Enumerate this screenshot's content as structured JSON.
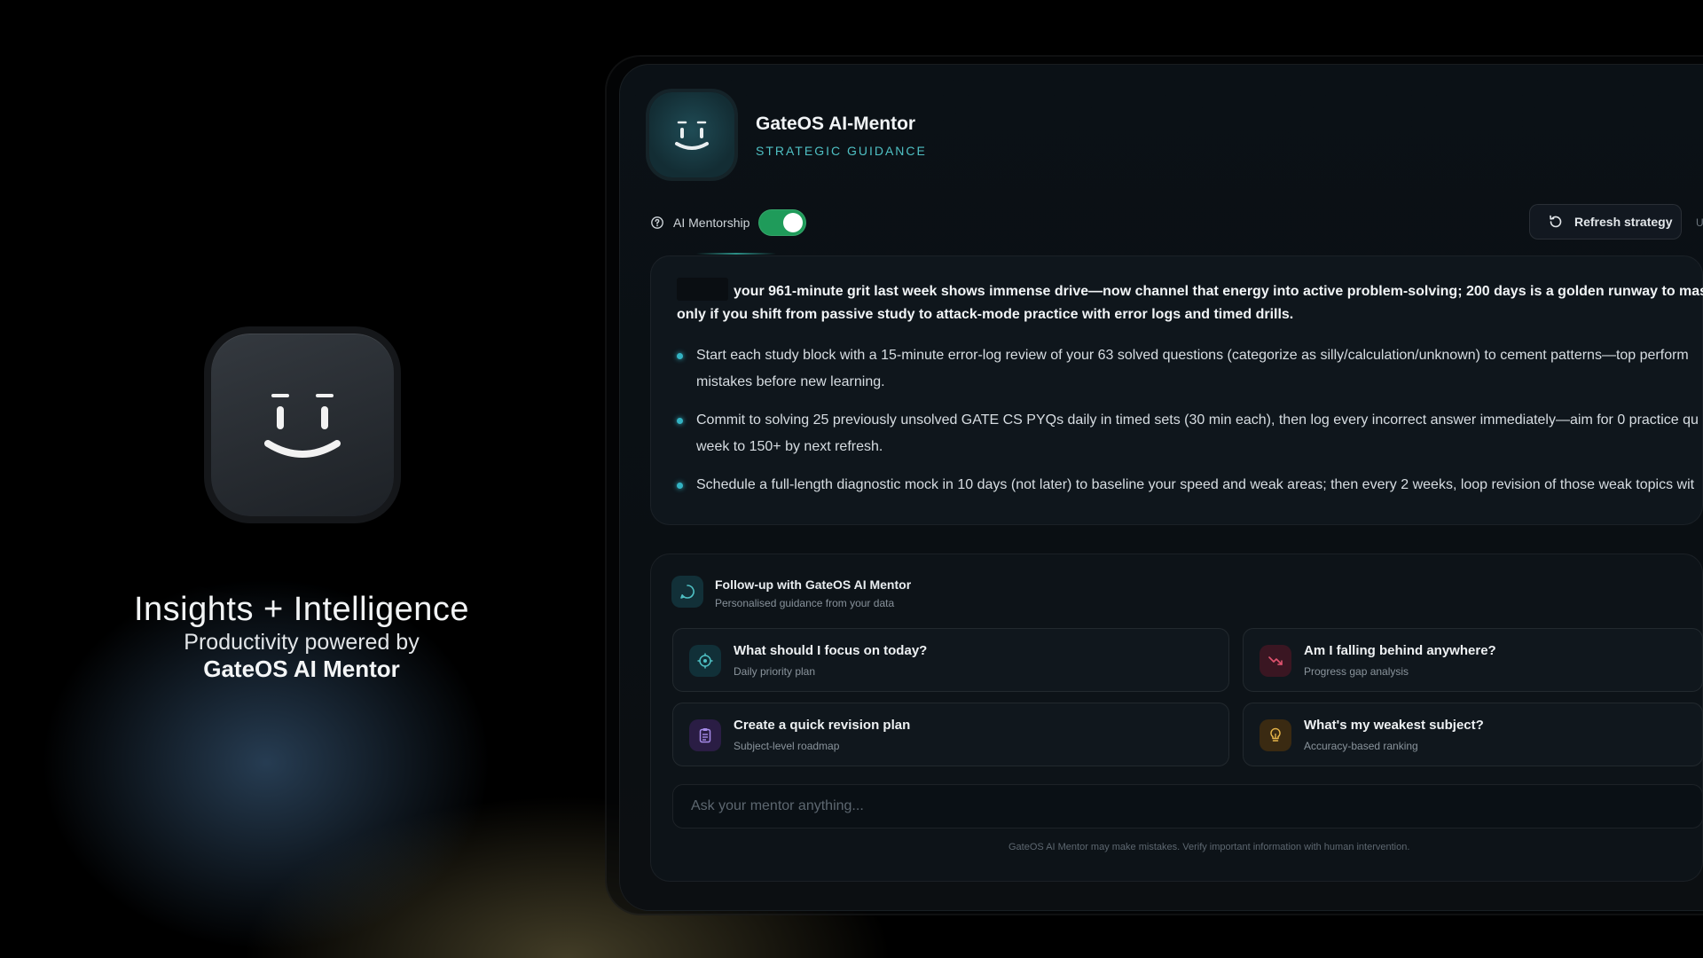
{
  "hero": {
    "title": "Insights + Intelligence",
    "subtitle": "Productivity powered by",
    "brand": "GateOS AI Mentor"
  },
  "header": {
    "title": "GateOS AI-Mentor",
    "subtitle": "STRATEGIC GUIDANCE"
  },
  "controls": {
    "mentorship_label": "AI Mentorship",
    "mentorship_enabled": true,
    "refresh_label": "Refresh strategy",
    "edge_fragment": "U"
  },
  "strategy": {
    "lead_line1": "your 961-minute grit last week shows immense drive—now channel that energy into active problem-solving; 200 days is a golden runway to master",
    "lead_line2": "only if you shift from passive study to attack-mode practice with error logs and timed drills.",
    "bullets": [
      {
        "line1": "Start each study block with a 15-minute error-log review of your 63 solved questions (categorize as silly/calculation/unknown) to cement patterns—top perform",
        "line2": "mistakes before new learning."
      },
      {
        "line1": "Commit to solving 25 previously unsolved GATE CS PYQs daily in timed sets (30 min each), then log every incorrect answer immediately—aim for 0 practice qu",
        "line2": "week to 150+ by next refresh."
      },
      {
        "line1": "Schedule a full-length diagnostic mock in 10 days (not later) to baseline your speed and weak areas; then every 2 weeks, loop revision of those weak topics wit",
        "line2": ""
      }
    ]
  },
  "followup": {
    "title": "Follow-up with GateOS AI Mentor",
    "subtitle": "Personalised guidance from your data",
    "questions": [
      {
        "title": "What should I focus on today?",
        "sub": "Daily priority plan",
        "icon": "target-icon"
      },
      {
        "title": "Am I falling behind anywhere?",
        "sub": "Progress gap analysis",
        "icon": "trend-down-icon"
      },
      {
        "title": "Create a quick revision plan",
        "sub": "Subject-level roadmap",
        "icon": "clipboard-icon"
      },
      {
        "title": "What's my weakest subject?",
        "sub": "Accuracy-based ranking",
        "icon": "lightbulb-icon"
      }
    ],
    "input_placeholder": "Ask your mentor anything...",
    "disclaimer": "GateOS AI Mentor may make mistakes. Verify important information with human intervention."
  },
  "colors": {
    "accent_teal": "#4fc0c4",
    "toggle_on": "#1f9b5a",
    "bullet": "#33b3c3"
  }
}
